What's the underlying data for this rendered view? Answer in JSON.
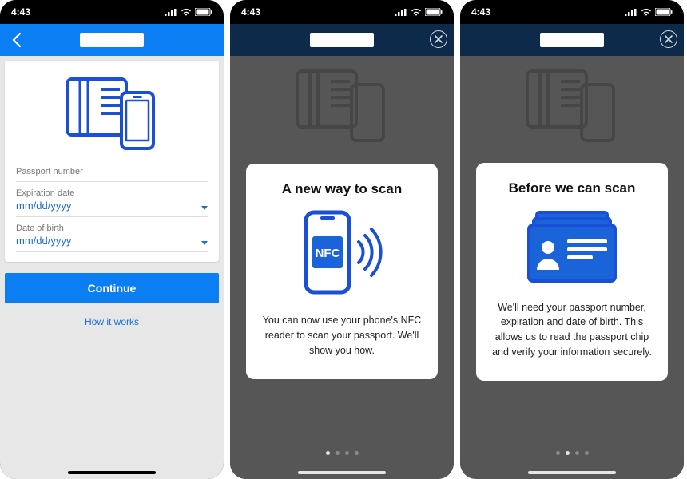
{
  "status": {
    "time": "4:43"
  },
  "screen1": {
    "fields": {
      "passport_label": "Passport number",
      "expiration_label": "Expiration date",
      "expiration_value": "mm/dd/yyyy",
      "dob_label": "Date of birth",
      "dob_value": "mm/dd/yyyy"
    },
    "continue_label": "Continue",
    "how_label": "How it works"
  },
  "screen2": {
    "title": "A new way to scan",
    "nfc_badge": "NFC",
    "body": "You can now use your phone's NFC reader to scan your passport. We'll show you how.",
    "page_index": 0,
    "page_count": 4
  },
  "screen3": {
    "title": "Before we can scan",
    "body": "We'll need your passport number, expiration and date of birth. This allows us to read the passport chip and verify your information securely.",
    "page_index": 1,
    "page_count": 4
  }
}
